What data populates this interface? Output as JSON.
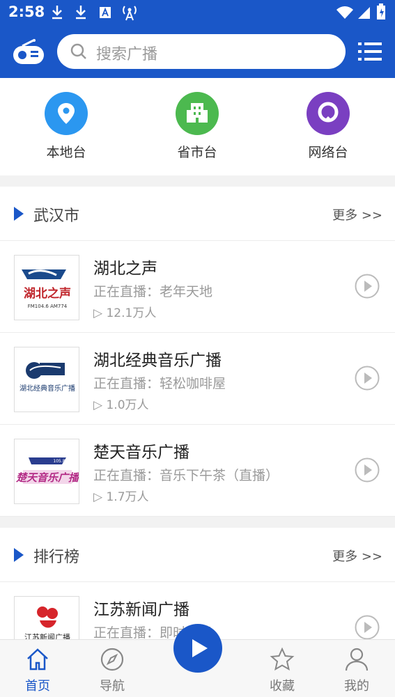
{
  "status_bar": {
    "time": "2:58"
  },
  "header": {
    "search_placeholder": "搜索广播"
  },
  "categories": [
    {
      "label": "本地台",
      "icon": "location-pin-icon",
      "color": "#2b97f0"
    },
    {
      "label": "省市台",
      "icon": "building-icon",
      "color": "#4cb94f"
    },
    {
      "label": "网络台",
      "icon": "globe-signal-icon",
      "color": "#7a3fc1"
    }
  ],
  "sections": [
    {
      "title": "武汉市",
      "more": "更多 >>",
      "items": [
        {
          "name": "湖北之声",
          "live": "正在直播：老年天地",
          "plays": "▷ 12.1万人",
          "logo_text": "湖北之声",
          "logo_sub": "FM104.6 AM774"
        },
        {
          "name": "湖北经典音乐广播",
          "live": "正在直播：轻松咖啡屋",
          "plays": "▷ 1.0万人",
          "logo_text": "湖北经典音乐广播"
        },
        {
          "name": "楚天音乐广播",
          "live": "正在直播：音乐下午茶（直播）",
          "plays": "▷ 1.7万人",
          "logo_text": "楚天音乐广播"
        }
      ]
    },
    {
      "title": "排行榜",
      "more": "更多 >>",
      "items": [
        {
          "name": "江苏新闻广播",
          "live": "正在直播：即时资讯",
          "logo_text": "江苏新闻广播"
        }
      ]
    }
  ],
  "tabbar": [
    {
      "label": "首页",
      "icon": "home-icon",
      "active": true
    },
    {
      "label": "导航",
      "icon": "compass-icon",
      "active": false
    },
    {
      "label": "收藏",
      "icon": "star-icon",
      "active": false
    },
    {
      "label": "我的",
      "icon": "user-icon",
      "active": false
    }
  ],
  "colors": {
    "primary": "#1a57c8",
    "muted": "#9a9a9a",
    "background_gap": "#f2f2f2"
  }
}
